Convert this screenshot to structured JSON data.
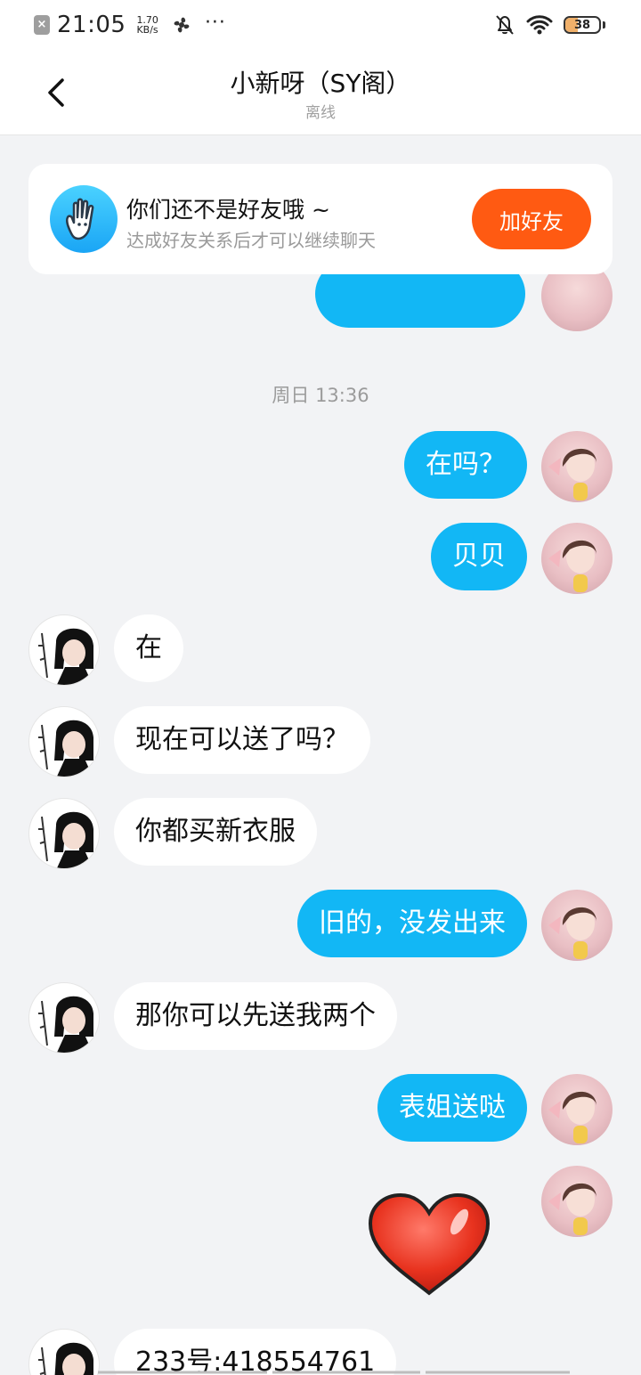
{
  "status_bar": {
    "time": "21:05",
    "speed_value": "1.70",
    "speed_unit": "KB/s",
    "more": "···",
    "battery": "38",
    "battery_level_percent": 38
  },
  "header": {
    "title": "小新呀（SY阁）",
    "status": "离线"
  },
  "friend_card": {
    "title": "你们还不是好友哦 ~",
    "subtitle": "达成好友关系后才可以继续聊天",
    "add_button": "加好友"
  },
  "chat": {
    "timestamp": "周日 13:36",
    "messages": [
      {
        "from": "me",
        "text": "在吗？"
      },
      {
        "from": "me",
        "text": "贝贝"
      },
      {
        "from": "other",
        "text": "在"
      },
      {
        "from": "other",
        "text": "现在可以送了吗？"
      },
      {
        "from": "other",
        "text": "你都买新衣服"
      },
      {
        "from": "me",
        "text": "旧的，没发出来"
      },
      {
        "from": "other",
        "text": "那你可以先送我两个"
      },
      {
        "from": "me",
        "text": "表姐送哒"
      },
      {
        "from": "me",
        "sticker": "heart-sticker"
      },
      {
        "from": "other",
        "text": "233号:418554761"
      }
    ]
  },
  "colors": {
    "accent_blue": "#12b7f5",
    "add_orange": "#ff5a12",
    "background": "#f2f3f5"
  }
}
